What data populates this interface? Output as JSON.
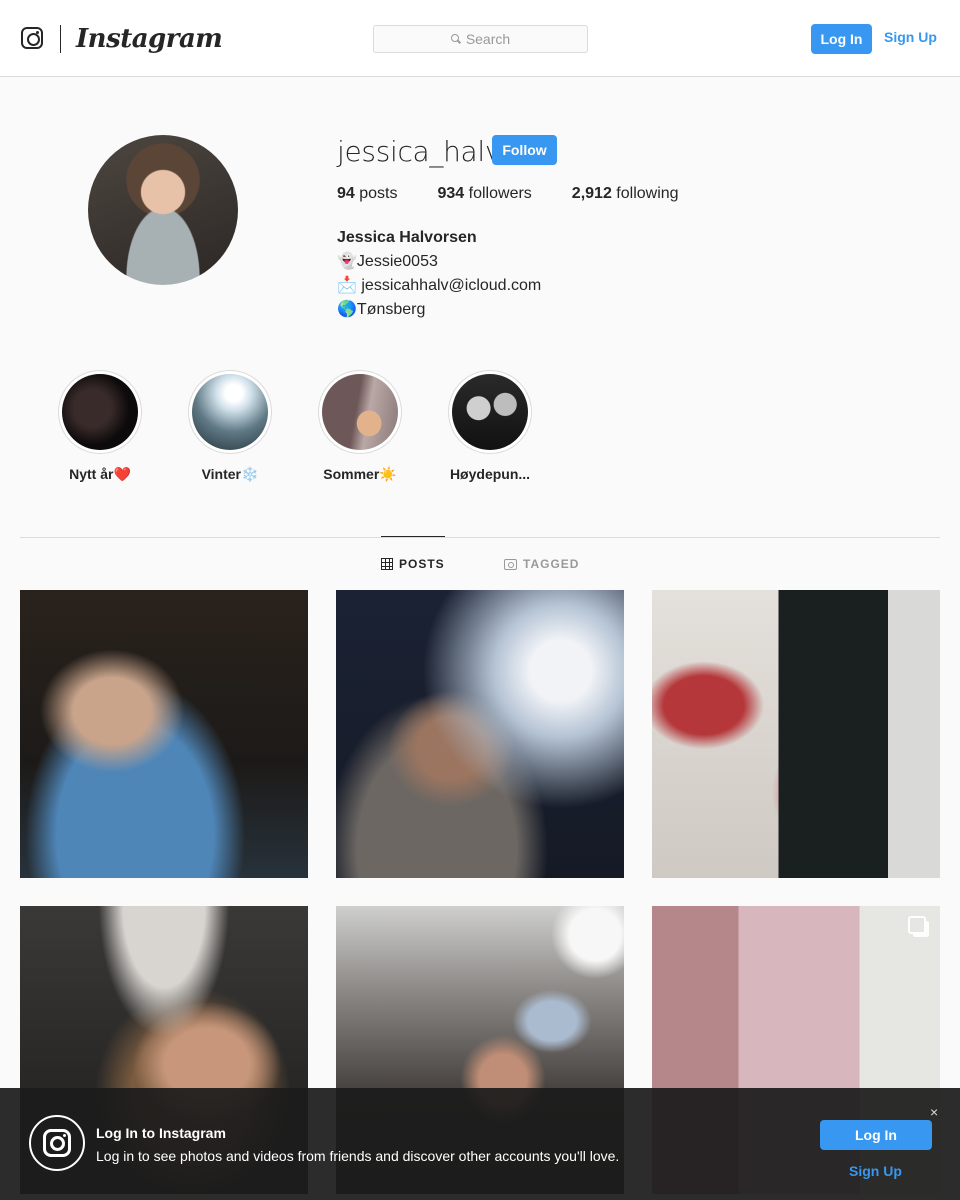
{
  "nav": {
    "wordmark": "Instagram",
    "search_placeholder": "Search",
    "login_label": "Log In",
    "signup_label": "Sign Up"
  },
  "profile": {
    "username": "jessica_halv",
    "follow_label": "Follow",
    "posts_count": "94",
    "posts_label": "posts",
    "followers_count": "934",
    "followers_label": "followers",
    "following_count": "2,912",
    "following_label": "following",
    "full_name": "Jessica Halvorsen",
    "bio_lines": [
      "👻Jessie0053",
      "📩 jessicahhalv@icloud.com",
      "🌎Tønsberg"
    ]
  },
  "highlights": [
    {
      "label": "Nytt år❤️"
    },
    {
      "label": "Vinter❄️"
    },
    {
      "label": "Sommer☀️"
    },
    {
      "label": "Høydepun..."
    }
  ],
  "tabs": {
    "posts": "POSTS",
    "tagged": "TAGGED"
  },
  "banner": {
    "title": "Log In to Instagram",
    "text": "Log in to see photos and videos from friends and discover other accounts you'll love.",
    "close": "×",
    "login_label": "Log In",
    "signup_label": "Sign Up"
  }
}
